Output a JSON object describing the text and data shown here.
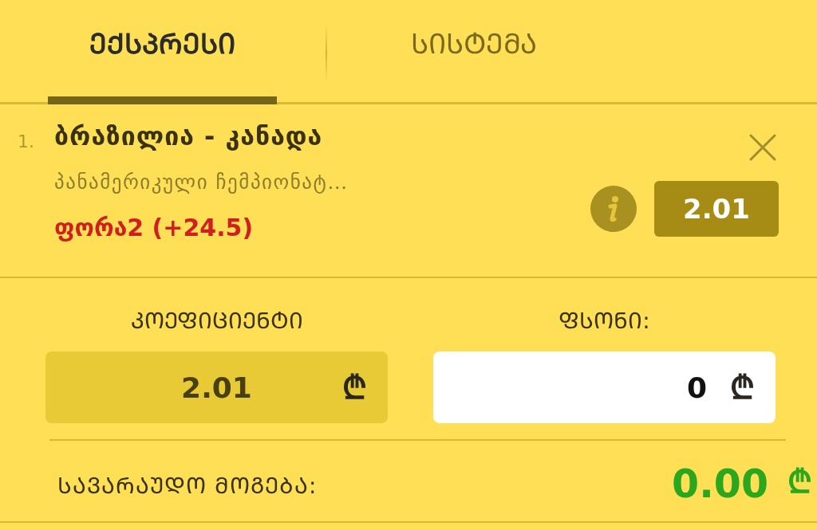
{
  "tabs": [
    {
      "label": "ᲔᲥᲡᲞᲠᲔᲡᲘ",
      "selected": true
    },
    {
      "label": "ᲡᲘᲡᲢᲔᲛᲐ",
      "selected": false
    }
  ],
  "bet": {
    "number": "1.",
    "title": "ბრაზილია - კანადა",
    "tournament": "პანამერიკული ჩემპიონატ…",
    "selection": "ფორა2 (+24.5)",
    "odds": "2.01"
  },
  "fields": [
    {
      "label": "ᲙᲝᲔᲤᲘᲪᲘᲔᲜᲢᲘ",
      "value": "2.01",
      "currency": "₾",
      "disabled": true
    },
    {
      "label": "ᲤᲡᲝᲜᲘ:",
      "value": "0",
      "currency": "₾",
      "disabled": false
    }
  ],
  "summary": {
    "label": "ᲡᲐᲕᲐᲠᲐᲣᲓᲝ ᲛᲝᲒᲔᲑᲐ:",
    "value": "0.00",
    "currency": "₾"
  }
}
